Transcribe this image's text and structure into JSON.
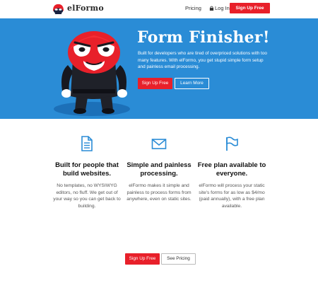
{
  "nav": {
    "brand": "elFormo",
    "pricing": "Pricing",
    "login": "Log In",
    "signup": "Sign Up Free"
  },
  "hero": {
    "title": "Form Finisher!",
    "description": "Built for developers who are tired of overpriced solutions with too many features. With elFormo, you get stupid simple form setup and painless email processing.",
    "signup": "Sign Up Free",
    "learn_more": "Learn More"
  },
  "features": [
    {
      "icon": "document-icon",
      "title": "Built for people that build websites.",
      "description": "No templates, no WYSIWYG editors, no fluff. We get out of your way so you can get back to building."
    },
    {
      "icon": "envelope-icon",
      "title": "Simple and painless processing.",
      "description": "elFormo makes it simple and painless to process forms from anywhere, even on static sites."
    },
    {
      "icon": "flag-icon",
      "title": "Free plan available to everyone.",
      "description": "elFormo will process your static site's forms for as low as $4/mo (paid annually), with a free plan available."
    }
  ],
  "bottom": {
    "signup": "Sign Up Free",
    "pricing": "See Pricing"
  },
  "colors": {
    "accent": "#e8202a",
    "hero_bg": "#2a8cd6",
    "icon": "#2a8cd6"
  }
}
